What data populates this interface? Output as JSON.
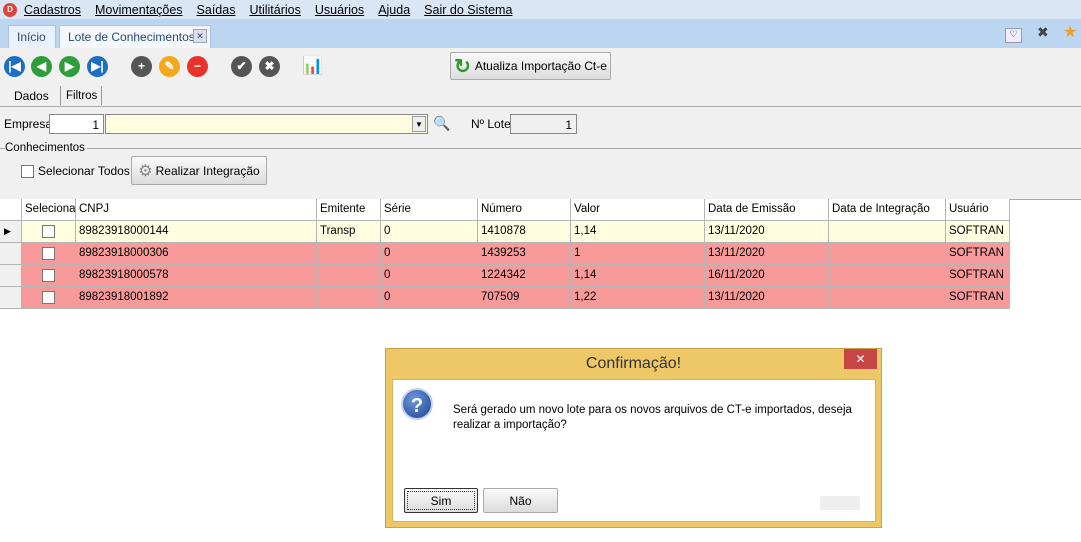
{
  "menu": {
    "items": [
      "Cadastros",
      "Movimentações",
      "Saídas",
      "Utilitários",
      "Usuários",
      "Ajuda",
      "Sair do Sistema"
    ]
  },
  "tabs": [
    {
      "label": "Início"
    },
    {
      "label": "Lote de Conhecimentos"
    }
  ],
  "toolbar": {
    "update_import_label": "Atualiza Importação Ct-e"
  },
  "subtabs": [
    "Dados",
    "Filtros"
  ],
  "form": {
    "empresa_label": "Empresa",
    "empresa_code": "1",
    "empresa_name": "",
    "lote_label": "Nº Lote",
    "lote_value": "1"
  },
  "section": {
    "title": "Conhecimentos",
    "select_all_label": "Selecionar Todos",
    "integrate_label": "Realizar Integração"
  },
  "table": {
    "columns": [
      "Selecionar",
      "CNPJ",
      "Emitente",
      "Série",
      "Número",
      "Valor",
      "Data de Emissão",
      "Data de Integração",
      "Usuário"
    ],
    "rows": [
      [
        "",
        "89823918000144",
        "Transp",
        "0",
        "1410878",
        "1,14",
        "13/11/2020",
        "",
        "SOFTRAN"
      ],
      [
        "",
        "89823918000306",
        "",
        "0",
        "1439253",
        "1",
        "13/11/2020",
        "",
        "SOFTRAN"
      ],
      [
        "",
        "89823918000578",
        "",
        "0",
        "1224342",
        "1,14",
        "16/11/2020",
        "",
        "SOFTRAN"
      ],
      [
        "",
        "89823918001892",
        "",
        "0",
        "707509",
        "1,22",
        "13/11/2020",
        "",
        "SOFTRAN"
      ]
    ],
    "row_colors": [
      "#fffde0",
      "#f89a9a",
      "#f89a9a",
      "#f89a9a"
    ]
  },
  "dialog": {
    "title": "Confirmação!",
    "message": "Será gerado um novo lote para os novos arquivos de CT-e importados, deseja realizar a importação?",
    "yes_label": "Sim",
    "no_label": "Não"
  }
}
